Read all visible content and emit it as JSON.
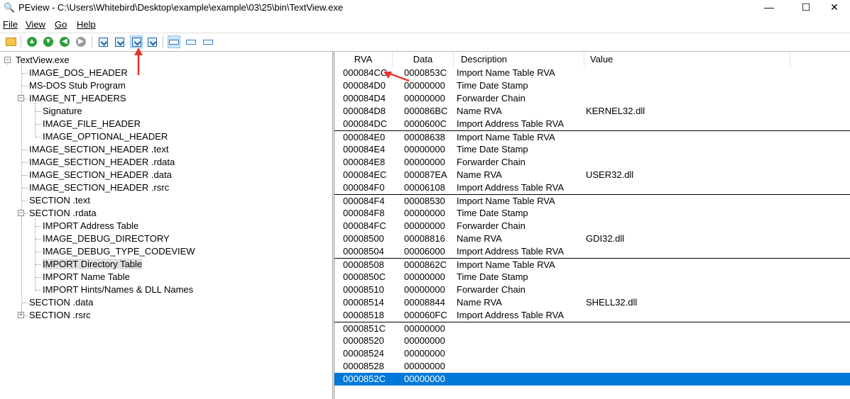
{
  "window": {
    "title": "PEview - C:\\Users\\Whitebird\\Desktop\\example\\example\\03\\25\\bin\\TextView.exe",
    "minimize_glyph": "—",
    "maximize_glyph": "☐",
    "close_glyph": "✕"
  },
  "menu": [
    "File",
    "View",
    "Go",
    "Help"
  ],
  "toolbar": {
    "pressed_button": "view-next-button",
    "icons": [
      "open-folder-icon",
      "up-arrow-icon",
      "down-arrow-icon",
      "back-arrow-icon",
      "forward-arrow-icon",
      "document-icon",
      "document-icon",
      "download-icon",
      "download-icon",
      "view-bytes-icon",
      "view-words-icon",
      "view-dwords-icon"
    ]
  },
  "tree": {
    "root": "TextView.exe",
    "items": [
      {
        "label": "IMAGE_DOS_HEADER"
      },
      {
        "label": "MS-DOS Stub Program"
      },
      {
        "label": "IMAGE_NT_HEADERS",
        "expanded": true
      },
      {
        "label": "Signature"
      },
      {
        "label": "IMAGE_FILE_HEADER"
      },
      {
        "label": "IMAGE_OPTIONAL_HEADER"
      },
      {
        "label": "IMAGE_SECTION_HEADER .text"
      },
      {
        "label": "IMAGE_SECTION_HEADER .rdata"
      },
      {
        "label": "IMAGE_SECTION_HEADER .data"
      },
      {
        "label": "IMAGE_SECTION_HEADER .rsrc"
      },
      {
        "label": "SECTION .text"
      },
      {
        "label": "SECTION .rdata",
        "expanded": true
      },
      {
        "label": "IMPORT Address Table"
      },
      {
        "label": "IMAGE_DEBUG_DIRECTORY"
      },
      {
        "label": "IMAGE_DEBUG_TYPE_CODEVIEW"
      },
      {
        "label": "IMPORT Directory Table",
        "selected": true
      },
      {
        "label": "IMPORT Name Table"
      },
      {
        "label": "IMPORT Hints/Names & DLL Names"
      },
      {
        "label": "SECTION .data"
      },
      {
        "label": "SECTION .rsrc",
        "expanded": false
      }
    ]
  },
  "table": {
    "columns": [
      "RVA",
      "Data",
      "Description",
      "Value"
    ],
    "rows": [
      {
        "rva": "000084CC",
        "data": "0000853C",
        "desc": "Import Name Table RVA",
        "value": "",
        "group_start": false
      },
      {
        "rva": "000084D0",
        "data": "00000000",
        "desc": "Time Date Stamp",
        "value": ""
      },
      {
        "rva": "000084D4",
        "data": "00000000",
        "desc": "Forwarder Chain",
        "value": ""
      },
      {
        "rva": "000084D8",
        "data": "000086BC",
        "desc": "Name RVA",
        "value": "KERNEL32.dll"
      },
      {
        "rva": "000084DC",
        "data": "0000600C",
        "desc": "Import Address Table RVA",
        "value": ""
      },
      {
        "rva": "000084E0",
        "data": "00008638",
        "desc": "Import Name Table RVA",
        "value": "",
        "group_start": true
      },
      {
        "rva": "000084E4",
        "data": "00000000",
        "desc": "Time Date Stamp",
        "value": ""
      },
      {
        "rva": "000084E8",
        "data": "00000000",
        "desc": "Forwarder Chain",
        "value": ""
      },
      {
        "rva": "000084EC",
        "data": "000087EA",
        "desc": "Name RVA",
        "value": "USER32.dll"
      },
      {
        "rva": "000084F0",
        "data": "00006108",
        "desc": "Import Address Table RVA",
        "value": ""
      },
      {
        "rva": "000084F4",
        "data": "00008530",
        "desc": "Import Name Table RVA",
        "value": "",
        "group_start": true
      },
      {
        "rva": "000084F8",
        "data": "00000000",
        "desc": "Time Date Stamp",
        "value": ""
      },
      {
        "rva": "000084FC",
        "data": "00000000",
        "desc": "Forwarder Chain",
        "value": ""
      },
      {
        "rva": "00008500",
        "data": "00008816",
        "desc": "Name RVA",
        "value": "GDI32.dll"
      },
      {
        "rva": "00008504",
        "data": "00006000",
        "desc": "Import Address Table RVA",
        "value": ""
      },
      {
        "rva": "00008508",
        "data": "0000862C",
        "desc": "Import Name Table RVA",
        "value": "",
        "group_start": true
      },
      {
        "rva": "0000850C",
        "data": "00000000",
        "desc": "Time Date Stamp",
        "value": ""
      },
      {
        "rva": "00008510",
        "data": "00000000",
        "desc": "Forwarder Chain",
        "value": ""
      },
      {
        "rva": "00008514",
        "data": "00008844",
        "desc": "Name RVA",
        "value": "SHELL32.dll"
      },
      {
        "rva": "00008518",
        "data": "000060FC",
        "desc": "Import Address Table RVA",
        "value": ""
      },
      {
        "rva": "0000851C",
        "data": "00000000",
        "desc": "",
        "value": "",
        "group_start": true
      },
      {
        "rva": "00008520",
        "data": "00000000",
        "desc": "",
        "value": ""
      },
      {
        "rva": "00008524",
        "data": "00000000",
        "desc": "",
        "value": ""
      },
      {
        "rva": "00008528",
        "data": "00000000",
        "desc": "",
        "value": ""
      },
      {
        "rva": "0000852C",
        "data": "00000000",
        "desc": "",
        "value": "",
        "selected": true
      }
    ]
  },
  "colors": {
    "selection": "#0078d7",
    "annotation_arrow": "#e8322b",
    "tool_green": "#2e9e3a"
  }
}
